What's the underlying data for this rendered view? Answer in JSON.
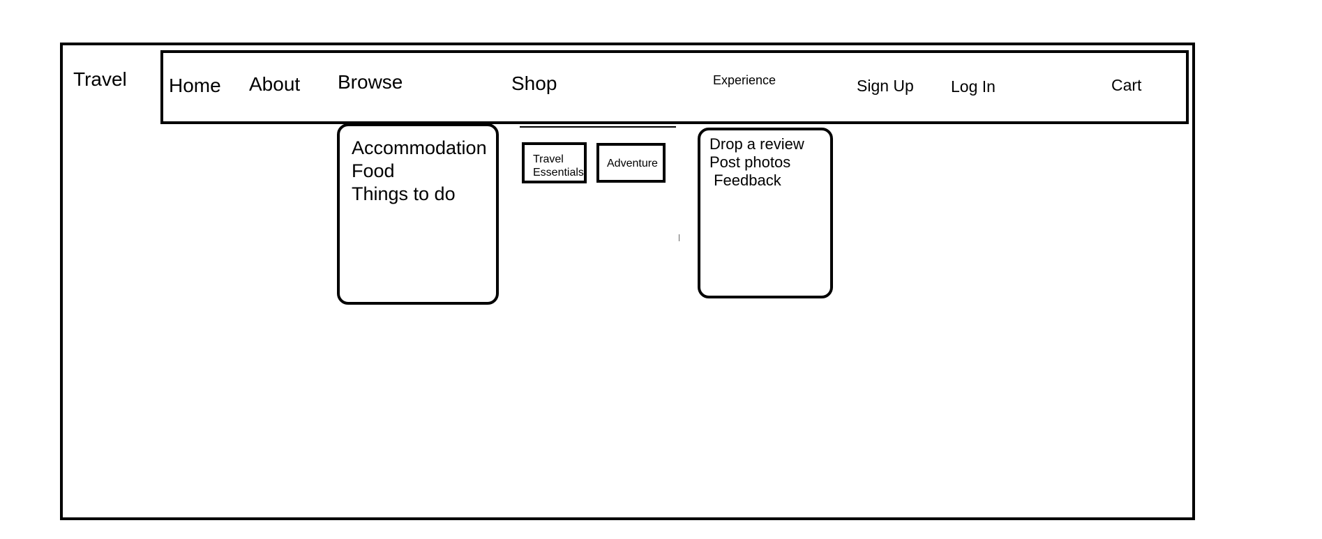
{
  "logo": {
    "text": "Travel"
  },
  "nav": {
    "home": "Home",
    "about": "About",
    "browse": "Browse",
    "shop": "Shop",
    "experience": "Experience",
    "sign_up": "Sign Up",
    "log_in": "Log In",
    "cart": "Cart"
  },
  "browse_menu": {
    "items": [
      "Accommodation",
      "Food",
      "Things to do"
    ]
  },
  "shop_menu": {
    "travel_essentials": [
      "Travel",
      "Essentials"
    ],
    "adventure": "Adventure"
  },
  "experience_menu": {
    "items": [
      "Drop a review",
      "Post photos",
      " Feedback"
    ]
  }
}
